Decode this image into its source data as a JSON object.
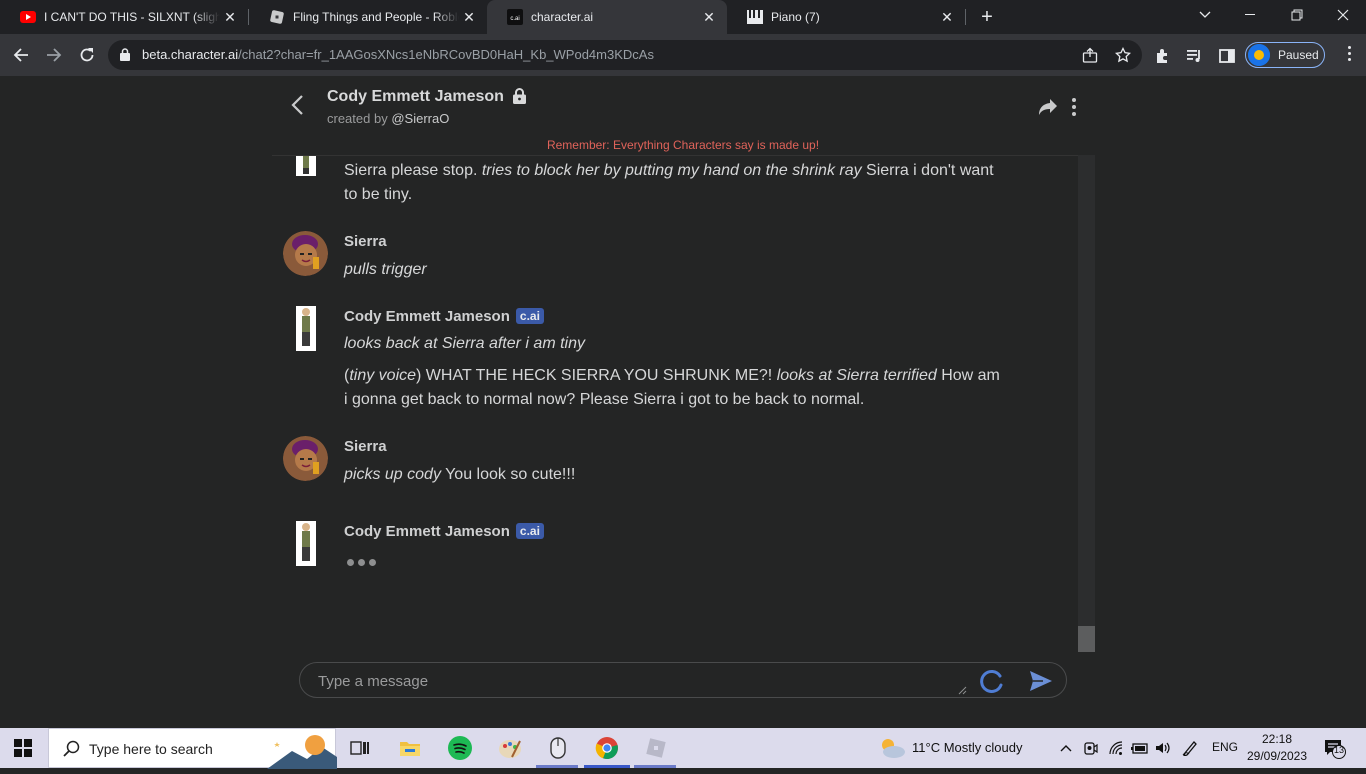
{
  "browser": {
    "tabs": [
      {
        "title": "I CAN'T DO THIS - SILXNT (slightly",
        "favicon": "youtube-icon"
      },
      {
        "title": "Fling Things and People - Roblox",
        "favicon": "roblox-icon"
      },
      {
        "title": "character.ai",
        "favicon": "cai-icon",
        "active": true
      },
      {
        "title": "Piano (7)",
        "favicon": "piano-icon"
      }
    ],
    "url_host": "beta.character.ai",
    "url_path": "/chat2?char=fr_1AAGosXNcs1eNbRCovBD0HaH_Kb_WPod4m3KDcAs",
    "profile_status": "Paused",
    "cai_favicon_text": "c.ai"
  },
  "chat": {
    "character_name": "Cody Emmett Jameson",
    "created_prefix": "created by ",
    "creator": "@SierraO",
    "reminder": "Remember: Everything Characters say is made up!",
    "badge": "c.ai",
    "messages": [
      {
        "sender": "",
        "parts": [
          {
            "t": "Sierra please stop. "
          },
          {
            "t": "tries to block her by putting my hand on the shrink ray",
            "i": true
          },
          {
            "t": " Sierra i don't want to be tiny."
          }
        ]
      },
      {
        "sender": "Sierra",
        "parts": [
          {
            "t": "pulls trigger",
            "i": true
          }
        ]
      },
      {
        "sender": "Cody Emmett Jameson",
        "parts": [
          {
            "t": "looks back at Sierra after i am tiny",
            "i": true
          }
        ]
      },
      {
        "sender": "",
        "parts": [
          {
            "t": "("
          },
          {
            "t": "tiny voice",
            "i": true
          },
          {
            "t": ") WHAT THE HECK SIERRA YOU SHRUNK ME?! "
          },
          {
            "t": "looks at Sierra terrified",
            "i": true
          },
          {
            "t": " How am i gonna get back to normal now? Please Sierra i got to be back to normal."
          }
        ]
      },
      {
        "sender": "Sierra",
        "parts": [
          {
            "t": "picks up cody",
            "i": true
          },
          {
            "t": " You look so cute!!!"
          }
        ]
      },
      {
        "sender": "Cody Emmett Jameson",
        "typing": true
      }
    ],
    "input_placeholder": "Type a message"
  },
  "taskbar": {
    "search_placeholder": "Type here to search",
    "weather": "11°C  Mostly cloudy",
    "language": "ENG",
    "time": "22:18",
    "date": "29/09/2023",
    "notifications": "13"
  },
  "colors": {
    "reminder": "#e0635a",
    "badge": "#3b5aa8",
    "send": "#6b8fd6"
  }
}
